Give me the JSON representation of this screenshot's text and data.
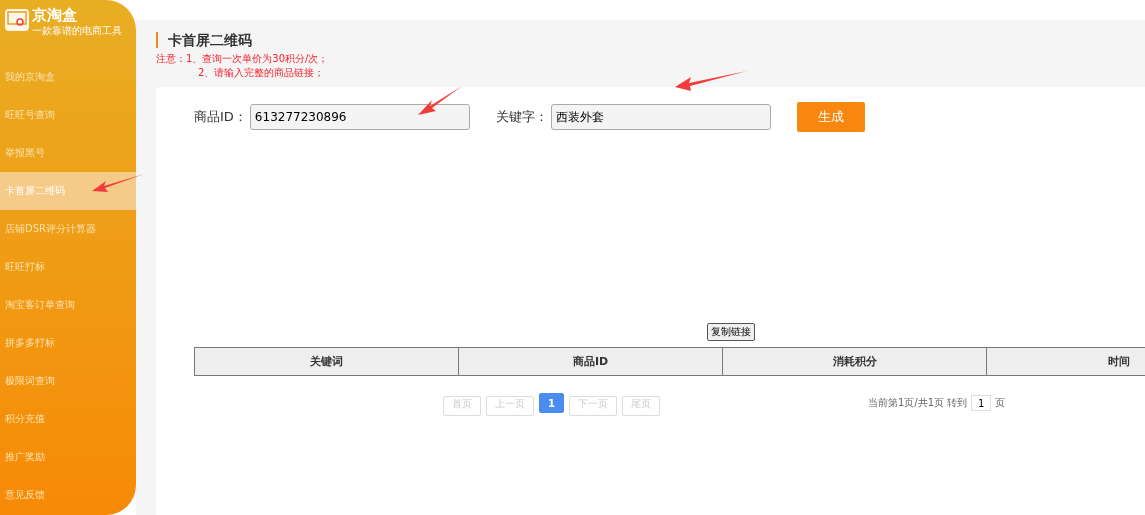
{
  "logo": {
    "name": "京淘盒",
    "tagline": "一款靠谱的电商工具"
  },
  "sidebar": {
    "items": [
      {
        "label": "我的京淘盒",
        "selected": false
      },
      {
        "label": "旺旺号查询",
        "selected": false
      },
      {
        "label": "举报黑号",
        "selected": false
      },
      {
        "label": "卡首屏二维码",
        "selected": true
      },
      {
        "label": "店铺DSR评分计算器",
        "selected": false
      },
      {
        "label": "旺旺打标",
        "selected": false
      },
      {
        "label": "淘宝客订单查询",
        "selected": false
      },
      {
        "label": "拼多多打标",
        "selected": false
      },
      {
        "label": "极限词查询",
        "selected": false
      },
      {
        "label": "积分充值",
        "selected": false
      },
      {
        "label": "推广奖励",
        "selected": false
      },
      {
        "label": "意见反馈",
        "selected": false
      }
    ]
  },
  "page": {
    "title": "卡首屏二维码",
    "notice_label": "注意：",
    "notices": [
      "1、查询一次单价为30积分/次；",
      "2、请输入完整的商品链接；"
    ]
  },
  "form": {
    "fields": [
      {
        "label": "商品ID：",
        "value": "613277230896"
      },
      {
        "label": "关键字：",
        "value": "西装外套"
      }
    ],
    "submit": "生成"
  },
  "copy_button": "复制链接",
  "table": {
    "columns": [
      "关键词",
      "商品ID",
      "消耗积分",
      "时间"
    ]
  },
  "pagination": {
    "buttons": [
      {
        "label": "首页",
        "kind": "nav",
        "selected": false
      },
      {
        "label": "上一页",
        "kind": "nav",
        "selected": false
      },
      {
        "label": "1",
        "kind": "page",
        "selected": true
      },
      {
        "label": "下一页",
        "kind": "nav",
        "selected": false
      },
      {
        "label": "尾页",
        "kind": "nav",
        "selected": false
      }
    ],
    "status": "当前第1页/共1页 转到",
    "goto_value": "1",
    "goto_suffix": "页"
  }
}
